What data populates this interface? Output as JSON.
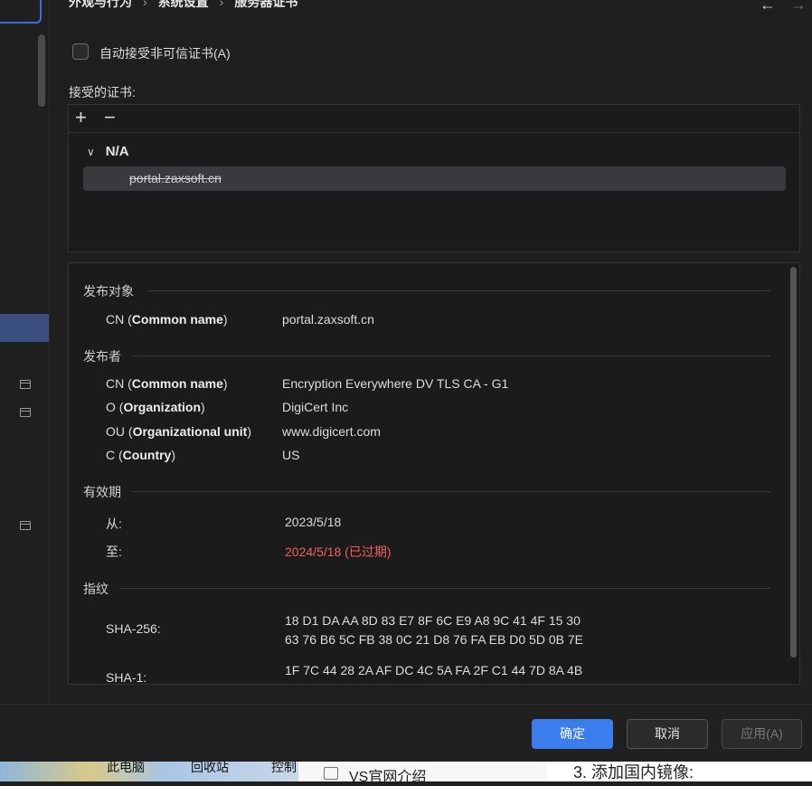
{
  "breadcrumb": [
    "外观与行为",
    "系统设置",
    "服务器证书"
  ],
  "nav": {
    "back": "←",
    "forward": "→"
  },
  "auto_accept": {
    "label": "自动接受非可信证书(A)",
    "checked": false
  },
  "accepted_label": "接受的证书:",
  "toolbar": {
    "add": "+",
    "remove": "−"
  },
  "cert_group": {
    "name": "N/A",
    "chevron": "⌄"
  },
  "cert_items": [
    "portal.zaxsoft.cn"
  ],
  "details": {
    "subject": {
      "title": "发布对象",
      "rows": [
        {
          "key_prefix": "CN (",
          "key_bold": "Common name",
          "key_suffix": ")",
          "value": "portal.zaxsoft.cn"
        }
      ]
    },
    "issuer": {
      "title": "发布者",
      "rows": [
        {
          "key_prefix": "CN (",
          "key_bold": "Common name",
          "key_suffix": ")",
          "value": "Encryption Everywhere DV TLS CA - G1"
        },
        {
          "key_prefix": "O (",
          "key_bold": "Organization",
          "key_suffix": ")",
          "value": "DigiCert Inc"
        },
        {
          "key_prefix": "OU (",
          "key_bold": "Organizational unit",
          "key_suffix": ")",
          "value": "www.digicert.com"
        },
        {
          "key_prefix": "C (",
          "key_bold": "Country",
          "key_suffix": ")",
          "value": "US"
        }
      ]
    },
    "validity": {
      "title": "有效期",
      "from_label": "从:",
      "from_value": "2023/5/18",
      "to_label": "至:",
      "to_value": "2024/5/18 (已过期)"
    },
    "fingerprint": {
      "title": "指纹",
      "sha256_label": "SHA-256:",
      "sha256_line1": "18 D1 DA AA 8D 83 E7 8F 6C E9 A8 9C 41 4F 15 30",
      "sha256_line2": "63 76 B6 5C FB 38 0C 21 D8 76 FA EB D0 5D 0B 7E",
      "sha1_label": "SHA-1:",
      "sha1_line1": "1F 7C 44 28 2A AF DC 4C 5A FA 2F C1 44 7D 8A 4B"
    }
  },
  "buttons": {
    "ok": "确定",
    "cancel": "取消",
    "apply": "应用(A)"
  },
  "background_strip": {
    "items": [
      "此电脑",
      "回收站",
      "控制"
    ],
    "doc_item": "VS官网介绍",
    "doc_heading": "3. 添加国内镜像:"
  },
  "colors": {
    "accent": "#3b7ded",
    "expired": "#f0605b",
    "selection": "#3a4f7e"
  }
}
